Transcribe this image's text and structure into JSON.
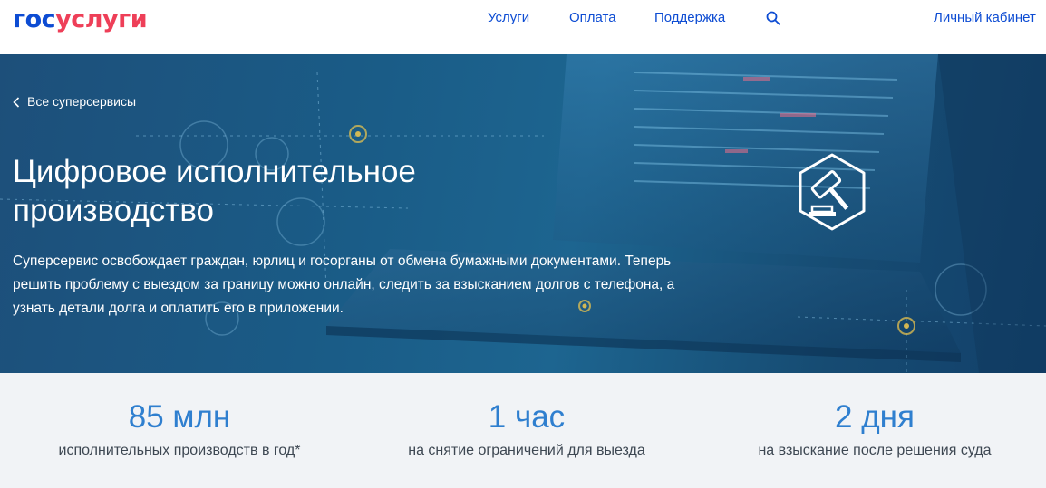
{
  "header": {
    "logo_part1": "гос",
    "logo_part2": "услуги",
    "nav": [
      "Услуги",
      "Оплата",
      "Поддержка"
    ],
    "search_icon": "search-icon",
    "cabinet": "Личный кабинет"
  },
  "hero": {
    "back_link": "Все суперсервисы",
    "title": "Цифровое исполнительное производство",
    "description": "Суперсервис освобождает граждан, юрлиц и госорганы от обмена бумажными документами. Теперь решить проблему с выездом за границу можно онлайн, следить за взысканием долгов с телефона, а узнать детали долга и оплатить его в приложении.",
    "icon": "gavel-icon"
  },
  "stats": [
    {
      "value": "85 млн",
      "label": "исполнительных производств в год*"
    },
    {
      "value": "1 час",
      "label": "на снятие ограничений для выезда"
    },
    {
      "value": "2 дня",
      "label": "на взыскание после решения суда"
    }
  ],
  "colors": {
    "brand_blue": "#0d4cd3",
    "brand_red": "#ee3f58",
    "stat_blue": "#2f7fcf",
    "stats_bg": "#f1f3f6"
  }
}
